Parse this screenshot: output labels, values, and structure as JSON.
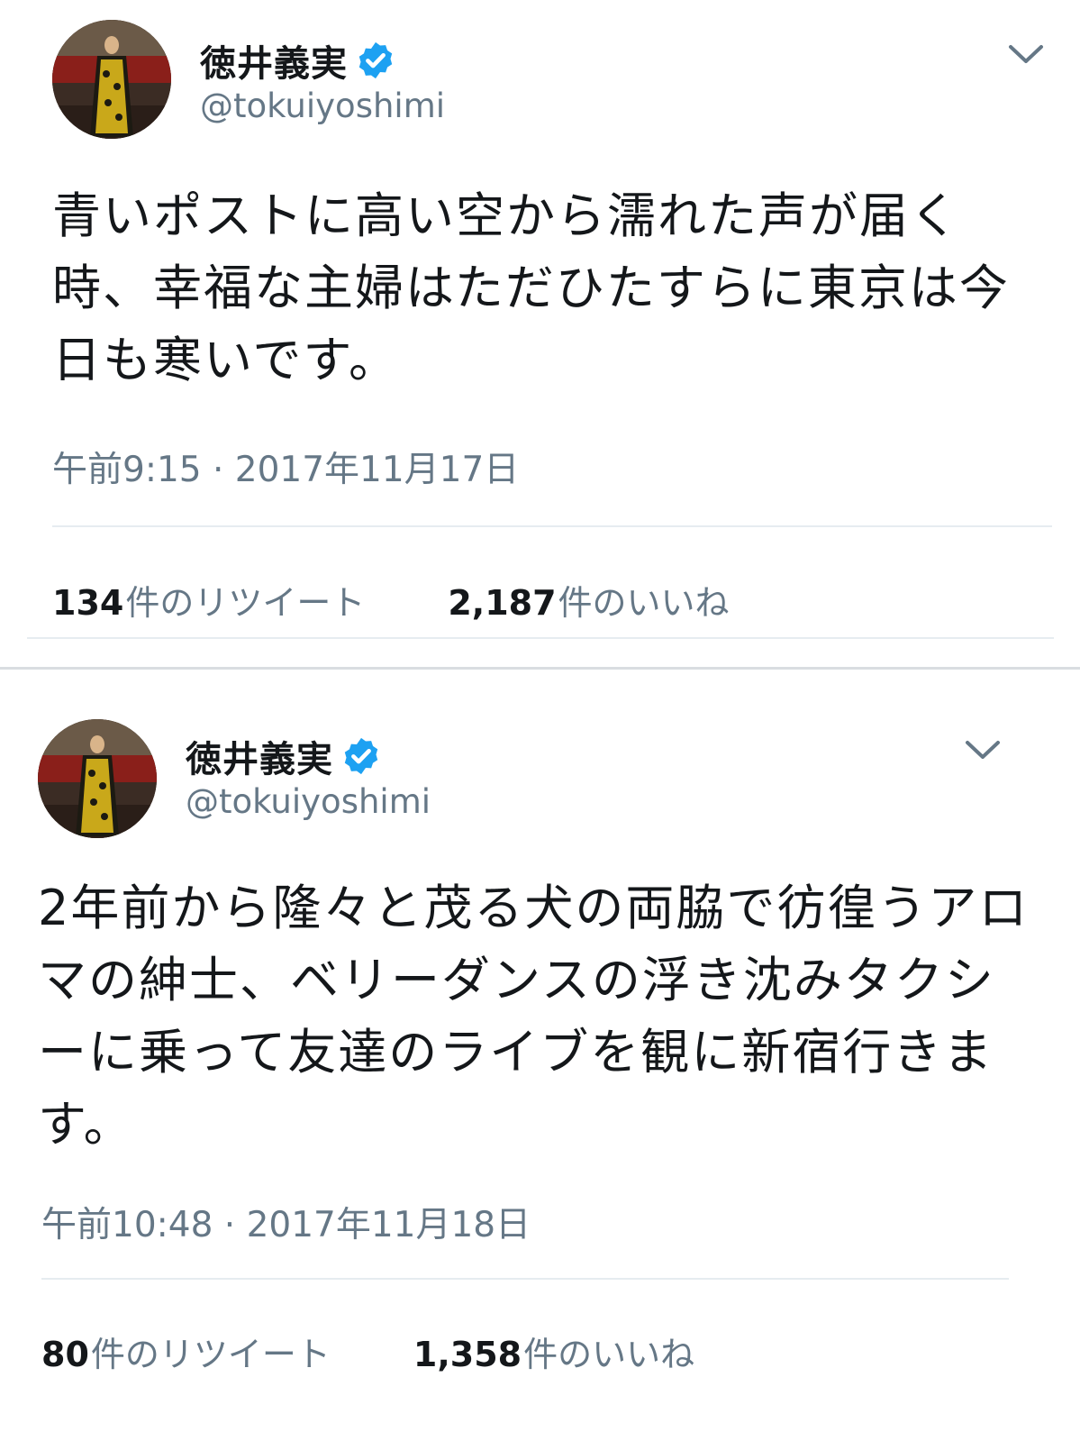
{
  "tweets": [
    {
      "name": "徳井義実",
      "handle": "@tokuiyoshimi",
      "text": "青いポストに高い空から濡れた声が届く\n時、幸福な主婦はただひたすらに東京は今\n日も寒いです。",
      "timestamp": "午前9:15 · 2017年11月17日",
      "retweets_count": "134",
      "retweets_label": "件のリツイート",
      "likes_count": "2,187",
      "likes_label": "件のいいね"
    },
    {
      "name": "徳井義実",
      "handle": "@tokuiyoshimi",
      "text": "2年前から隆々と茂る犬の両脇で彷徨うアロ\nマの紳士、ベリーダンスの浮き沈みタクシ\nーに乗って友達のライブを観に新宿行きま\nす。",
      "timestamp": "午前10:48 · 2017年11月18日",
      "retweets_count": "80",
      "retweets_label": "件のリツイート",
      "likes_count": "1,358",
      "likes_label": "件のいいね"
    }
  ],
  "icons": {
    "verified": "verified-badge-icon",
    "chevron": "chevron-down-icon"
  },
  "colors": {
    "verified_blue": "#1da1f2",
    "secondary_text": "#657786",
    "primary_text": "#14171a",
    "divider": "#e6ecf0"
  }
}
